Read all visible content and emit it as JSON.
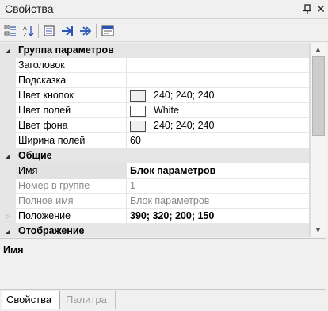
{
  "window": {
    "title": "Свойства"
  },
  "toolbar": {
    "buttons": [
      {
        "icon": "categorized-view-icon"
      },
      {
        "icon": "alphabetical-sort-icon"
      },
      {
        "icon": "property-pages-icon"
      },
      {
        "icon": "arrow-right-icon"
      },
      {
        "icon": "double-arrow-right-icon"
      },
      {
        "icon": "window-properties-icon"
      }
    ]
  },
  "grid": {
    "groups": [
      {
        "title": "Группа параметров",
        "rows": [
          {
            "name": "Заголовок",
            "value": ""
          },
          {
            "name": "Подсказка",
            "value": ""
          },
          {
            "name": "Цвет кнопок",
            "value": "240; 240; 240",
            "swatch": "#f0f0f0"
          },
          {
            "name": "Цвет полей",
            "value": "White",
            "swatch": "#ffffff"
          },
          {
            "name": "Цвет фона",
            "value": "240; 240; 240",
            "swatch": "#f0f0f0"
          },
          {
            "name": "Ширина полей",
            "value": "60"
          }
        ]
      },
      {
        "title": "Общие",
        "rows": [
          {
            "name": "Имя",
            "value": "Блок параметров",
            "selected": true
          },
          {
            "name": "Номер в группе",
            "value": "1",
            "readonly": true
          },
          {
            "name": "Полное имя",
            "value": "Блок параметров",
            "readonly": true
          },
          {
            "name": "Положение",
            "value": "390; 320; 200; 150",
            "expandable": true
          }
        ]
      },
      {
        "title": "Отображение",
        "rows": []
      }
    ]
  },
  "description": {
    "title": "Имя"
  },
  "tabs": [
    {
      "label": "Свойства",
      "active": true
    },
    {
      "label": "Палитра",
      "active": false
    }
  ]
}
